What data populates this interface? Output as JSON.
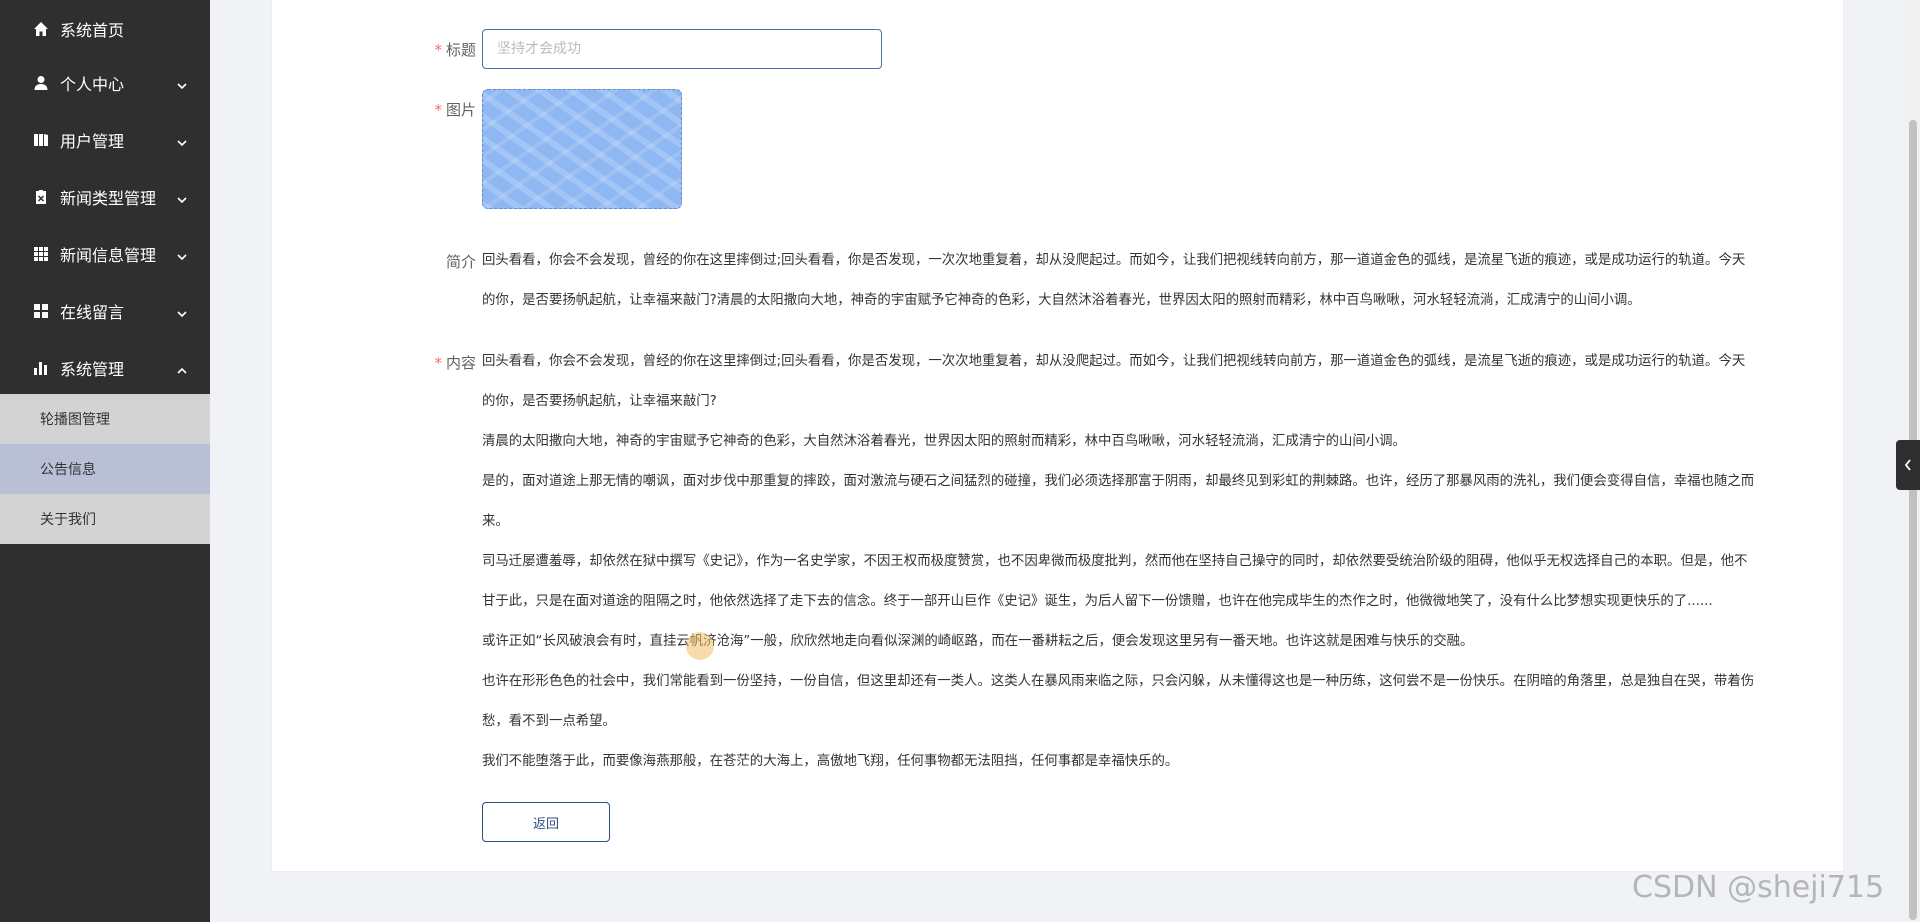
{
  "sidebar": {
    "items": [
      {
        "label": "系统首页",
        "icon": "home-icon"
      },
      {
        "label": "个人中心",
        "icon": "user-icon"
      },
      {
        "label": "用户管理",
        "icon": "users-management-icon"
      },
      {
        "label": "新闻类型管理",
        "icon": "clipboard-icon"
      },
      {
        "label": "新闻信息管理",
        "icon": "grid-icon"
      },
      {
        "label": "在线留言",
        "icon": "apps-icon"
      },
      {
        "label": "系统管理",
        "icon": "bar-chart-icon"
      }
    ],
    "submenu": [
      {
        "label": "轮播图管理"
      },
      {
        "label": "公告信息"
      },
      {
        "label": "关于我们"
      }
    ]
  },
  "form": {
    "title_label": "标题",
    "title_placeholder": "坚持才会成功",
    "image_label": "图片",
    "intro_label": "简介",
    "intro_lines": [
      "回头看看，你会不会发现，曾经的你在这里摔倒过;回头看看，你是否发现，一次次地重复着，却从没爬起过。而如今，让我们把视线转向前方，那一道道金色的弧线，是流星飞逝的痕迹，或是成功运行的轨道。今天",
      "的你，是否要扬帆起航，让幸福来敲门?清晨的太阳撒向大地，神奇的宇宙赋予它神奇的色彩，大自然沐浴着春光，世界因太阳的照射而精彩，林中百鸟啾啾，河水轻轻流淌，汇成清宁的山间小调。"
    ],
    "content_label": "内容",
    "content_lines": [
      "回头看看，你会不会发现，曾经的你在这里摔倒过;回头看看，你是否发现，一次次地重复着，却从没爬起过。而如今，让我们把视线转向前方，那一道道金色的弧线，是流星飞逝的痕迹，或是成功运行的轨道。今天",
      "的你，是否要扬帆起航，让幸福来敲门?",
      "清晨的太阳撒向大地，神奇的宇宙赋予它神奇的色彩，大自然沐浴着春光，世界因太阳的照射而精彩，林中百鸟啾啾，河水轻轻流淌，汇成清宁的山间小调。",
      "是的，面对道途上那无情的嘲讽，面对步伐中那重复的摔跤，面对激流与硬石之间猛烈的碰撞，我们必须选择那富于阴雨，却最终见到彩虹的荆棘路。也许，经历了那暴风雨的洗礼，我们便会变得自信，幸福也随之而",
      "来。",
      "司马迁屡遭羞辱，却依然在狱中撰写《史记》，作为一名史学家，不因王权而极度赞赏，也不因卑微而极度批判，然而他在坚持自己操守的同时，却依然要受统治阶级的阻碍，他似乎无权选择自己的本职。但是，他不",
      "甘于此，只是在面对道途的阻隔之时，他依然选择了走下去的信念。终于一部开山巨作《史记》诞生，为后人留下一份馈赠，也许在他完成毕生的杰作之时，他微微地笑了，没有什么比梦想实现更快乐的了......",
      "或许正如“长风破浪会有时，直挂云帆济沧海”一般，欣欣然地走向看似深渊的崎岖路，而在一番耕耘之后，便会发现这里另有一番天地。也许这就是困难与快乐的交融。",
      "也许在形形色色的社会中，我们常能看到一份坚持，一份自信，但这里却还有一类人。这类人在暴风雨来临之际，只会闪躲，从未懂得这也是一种历练，这何尝不是一份快乐。在阴暗的角落里，总是独自在哭，带着伤",
      "愁，看不到一点希望。",
      "我们不能堕落于此，而要像海燕那般，在苍茫的大海上，高傲地飞翔，任何事物都无法阻挡，任何事都是幸福快乐的。"
    ],
    "back_label": "返回"
  },
  "watermark": "CSDN @sheji715"
}
